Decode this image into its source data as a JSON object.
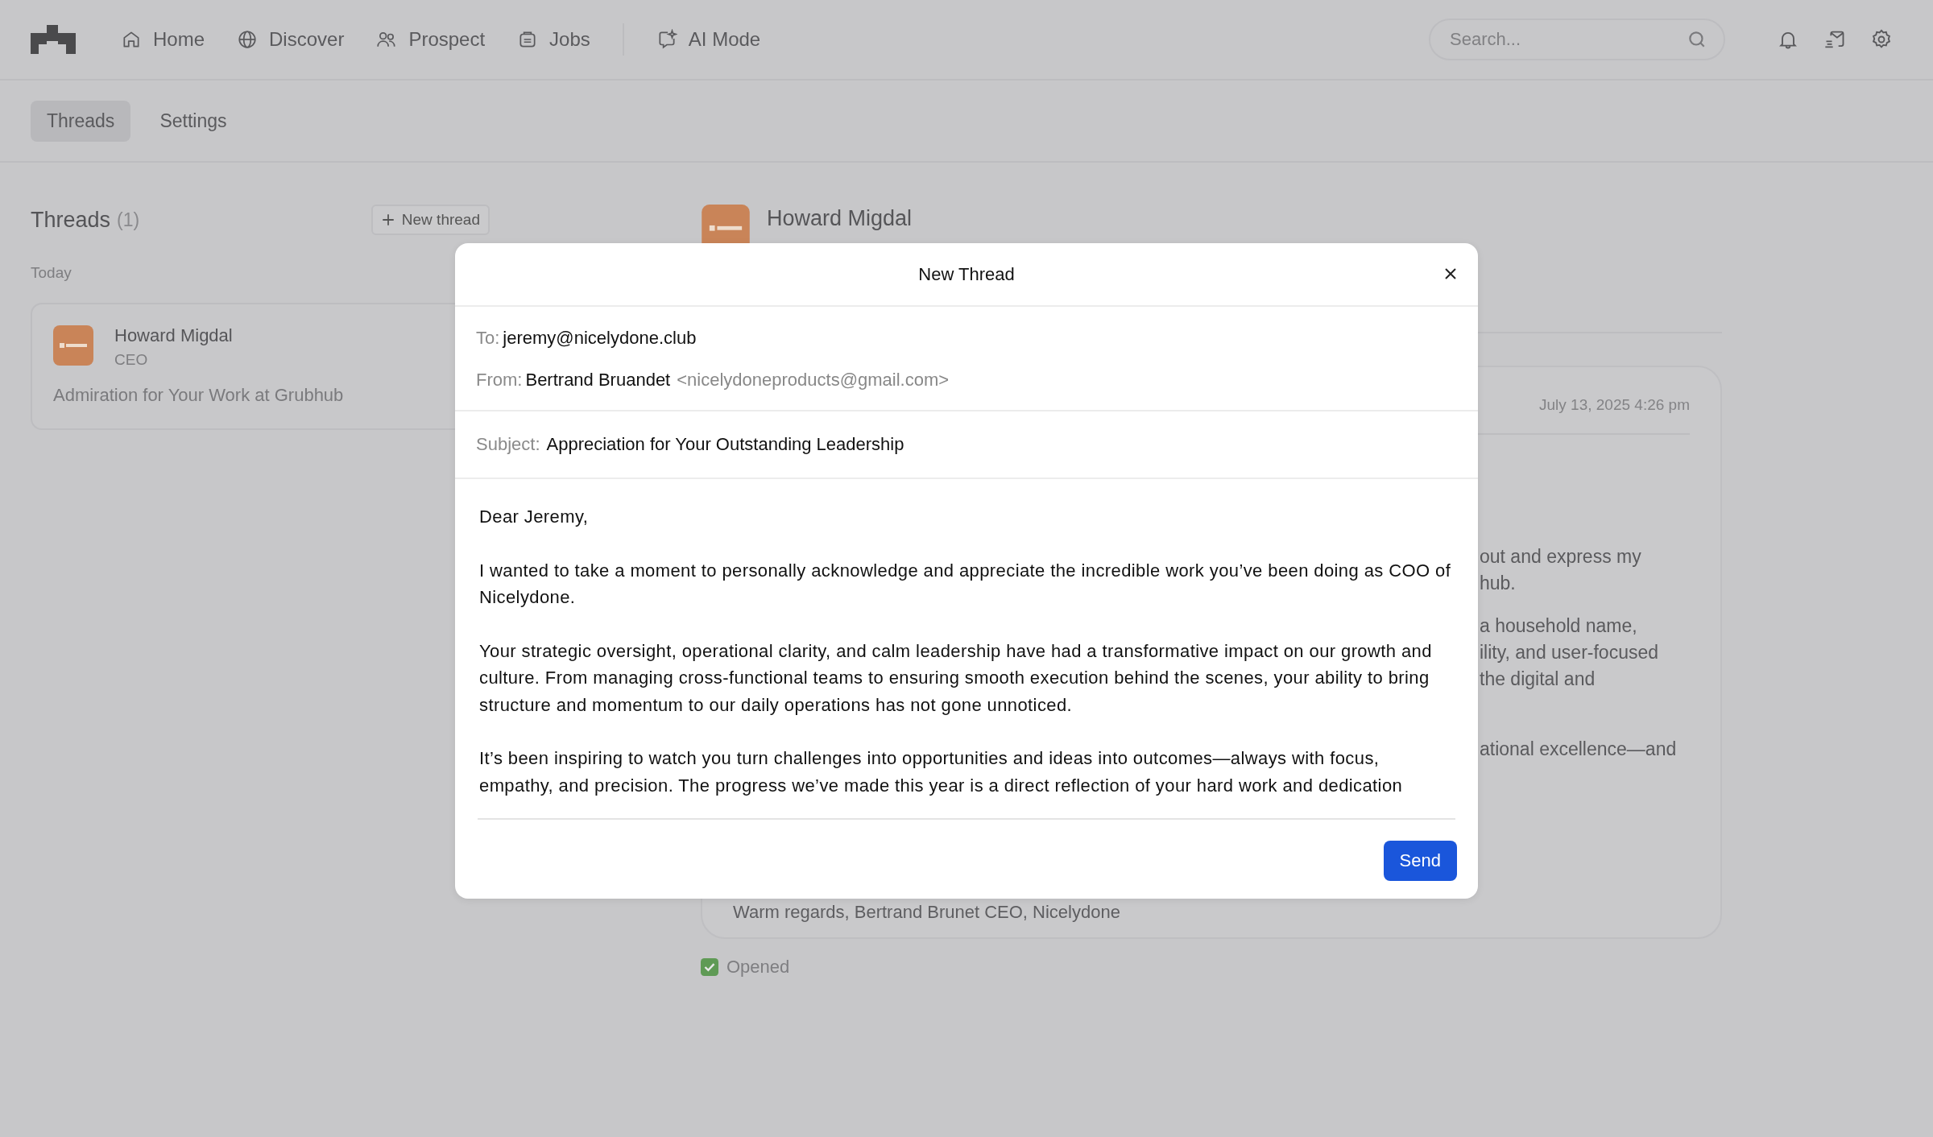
{
  "nav": {
    "items": [
      {
        "kind": "home",
        "label": "Home"
      },
      {
        "kind": "globe",
        "label": "Discover"
      },
      {
        "kind": "people",
        "label": "Prospect"
      },
      {
        "kind": "briefcase",
        "label": "Jobs"
      },
      {
        "kind": "ai",
        "label": "AI Mode"
      }
    ],
    "search": {
      "placeholder": "Search..."
    }
  },
  "tabs": [
    {
      "label": "Threads",
      "selected": true
    },
    {
      "label": "Settings",
      "selected": false
    }
  ],
  "threads": {
    "title": "Threads",
    "count": "(1)",
    "new_button": "New thread",
    "group": "Today",
    "items": [
      {
        "name": "Howard Migdal",
        "role": "CEO",
        "subject": "Admiration for Your Work at Grubhub"
      }
    ]
  },
  "conversation": {
    "name": "Howard Migdal",
    "date": "July 13, 2025 4:26 pm",
    "fragments": [
      [
        "out and express my",
        "hub."
      ],
      [
        "a household name,",
        "ility, and user-focused",
        "the digital and"
      ],
      [
        "ational excellence—and"
      ]
    ],
    "signature": "Warm regards, Bertrand Brunet CEO, Nicelydone",
    "status": "Opened"
  },
  "modal": {
    "title": "New Thread",
    "to_label": "To:",
    "to": "jeremy@nicelydone.club",
    "from_label": "From:",
    "from_name": "Bertrand Bruandet",
    "from_email": "<nicelydoneproducts@gmail.com>",
    "subject_label": "Subject:",
    "subject": "Appreciation for Your Outstanding Leadership",
    "body": [
      "Dear Jeremy,",
      "I wanted to take a moment to personally acknowledge and appreciate the incredible work you’ve been doing as COO of Nicelydone.",
      "Your strategic oversight, operational clarity, and calm leadership have had a transformative impact on our growth and culture. From managing cross-functional teams to ensuring smooth execution behind the scenes, your ability to bring structure and momentum to our daily operations has not gone unnoticed.",
      "It’s been inspiring to watch you turn challenges into opportunities and ideas into outcomes—always with focus, empathy, and precision. The progress we’ve made this year is a direct reflection of your hard work and dedication"
    ],
    "send": "Send"
  }
}
